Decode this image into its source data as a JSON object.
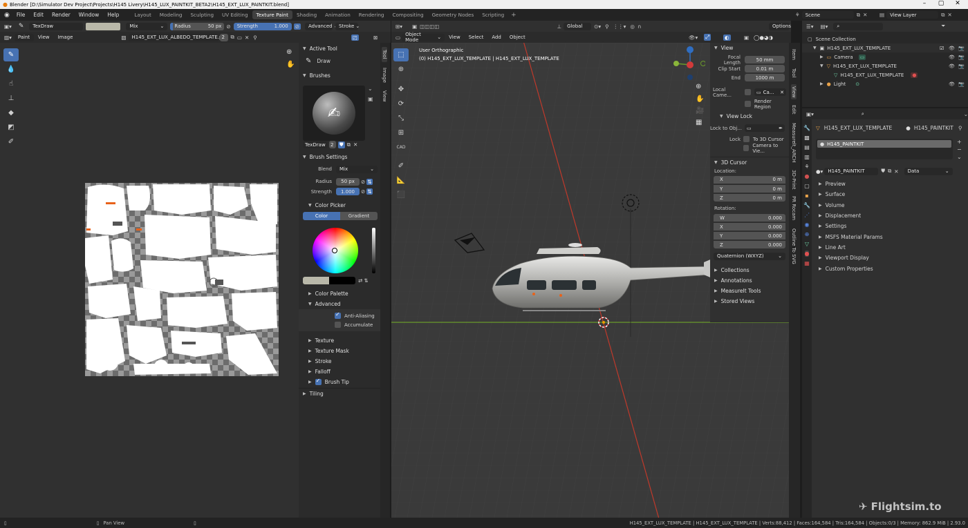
{
  "window": {
    "title": "Blender [D:\\Simulator Dev Project\\Projects\\H145 Livery\\H145_LUX_PAINTKIT_BETA2\\H145_EXT_LUX_PAINTKIT.blend]"
  },
  "menu": [
    "File",
    "Edit",
    "Render",
    "Window",
    "Help"
  ],
  "workspaces": [
    "Layout",
    "Modeling",
    "Sculpting",
    "UV Editing",
    "Texture Paint",
    "Shading",
    "Animation",
    "Rendering",
    "Compositing",
    "Geometry Nodes",
    "Scripting"
  ],
  "active_workspace": "Texture Paint",
  "scene": {
    "name": "Scene",
    "view_layer": "View Layer"
  },
  "tool_header": {
    "brush": "TexDraw",
    "blend": "Mix",
    "radius_label": "Radius",
    "radius_value": "50 px",
    "strength_label": "Strength",
    "strength_value": "1.000",
    "advanced": "Advanced",
    "stroke": "Stroke"
  },
  "image_editor": {
    "mode": "Paint",
    "view": "View",
    "image": "Image",
    "image_name": "H145_EXT_LUX_ALBEDO_TEMPLATE.png",
    "users": "2"
  },
  "sidebar": {
    "tabs": [
      "Tool",
      "Image",
      "View"
    ],
    "active_tool_header": "Active Tool",
    "active_tool": "Draw",
    "brushes_header": "Brushes",
    "brush_name": "TexDraw",
    "brush_users": "2",
    "brush_settings_header": "Brush Settings",
    "blend_label": "Blend",
    "blend_value": "Mix",
    "radius_label": "Radius",
    "radius_value": "50 px",
    "strength_label": "Strength",
    "strength_value": "1.000",
    "color_picker": "Color Picker",
    "color_tab": "Color",
    "gradient_tab": "Gradient",
    "color_palette": "Color Palette",
    "advanced": "Advanced",
    "anti_aliasing": "Anti-Aliasing",
    "accumulate": "Accumulate",
    "texture": "Texture",
    "texture_mask": "Texture Mask",
    "stroke": "Stroke",
    "falloff": "Falloff",
    "brush_tip": "Brush Tip",
    "tiling": "Tiling"
  },
  "viewport": {
    "mode": "Object Mode",
    "menus": [
      "View",
      "Select",
      "Add",
      "Object"
    ],
    "orientation": "Global",
    "options": "Options",
    "overlay_line1": "User Orthographic",
    "overlay_line2": "(0) H145_EXT_LUX_TEMPLATE | H145_EXT_LUX_TEMPLATE",
    "n_tabs": [
      "Item",
      "Tool",
      "View",
      "Edit",
      "Measurelt_ARCH",
      "3D-Print",
      "PR Rocam",
      "Outline To SVG"
    ],
    "view_panel": {
      "header": "View",
      "focal_length_label": "Focal Length",
      "focal_length": "50 mm",
      "clip_start_label": "Clip Start",
      "clip_start": "0.01 m",
      "end_label": "End",
      "end": "1000 m",
      "local_camera_label": "Local Came...",
      "local_camera_value": "Ca...",
      "render_region": "Render Region",
      "view_lock_header": "View Lock",
      "lock_to_obj_label": "Lock to Obj...",
      "lock_label": "Lock",
      "to_3d_cursor": "To 3D Cursor",
      "camera_to_view": "Camera to Vie..."
    },
    "cursor_panel": {
      "header": "3D Cursor",
      "location_label": "Location:",
      "x_label": "X",
      "x": "0 m",
      "y_label": "Y",
      "y": "0 m",
      "z_label": "Z",
      "z": "0 m",
      "rotation_label": "Rotation:",
      "w_label": "W",
      "w": "0.000",
      "rx_label": "X",
      "rx": "0.000",
      "ry_label": "Y",
      "ry": "0.000",
      "rz_label": "Z",
      "rz": "0.000",
      "rotation_mode": "Quaternion (WXYZ)"
    },
    "extra_panels": [
      "Collections",
      "Annotations",
      "MeasureIt Tools",
      "Stored Views"
    ]
  },
  "outliner": {
    "root": "Scene Collection",
    "items": [
      {
        "label": "H145_EXT_LUX_TEMPLATE",
        "level": 1,
        "icon": "collection-icon"
      },
      {
        "label": "Camera",
        "level": 2,
        "icon": "camera-icon"
      },
      {
        "label": "H145_EXT_LUX_TEMPLATE",
        "level": 2,
        "icon": "mesh-icon"
      },
      {
        "label": "H145_EXT_LUX_TEMPLATE",
        "level": 3,
        "icon": "mesh-data-icon"
      },
      {
        "label": "Light",
        "level": 2,
        "icon": "light-icon"
      }
    ]
  },
  "properties": {
    "object": "H145_EXT_LUX_TEMPLATE",
    "material": "H145_PAINTKIT",
    "slot": "H145_PAINTKIT",
    "material_field": "H145_PAINTKIT",
    "link": "Data",
    "sections": [
      "Preview",
      "Surface",
      "Volume",
      "Displacement",
      "Settings",
      "MSFS Material Params",
      "Line Art",
      "Viewport Display",
      "Custom Properties"
    ]
  },
  "statusbar": {
    "left": "Pan View",
    "right": "H145_EXT_LUX_TEMPLATE | H145_EXT_LUX_TEMPLATE | Verts:88,412 | Faces:164,584 | Tris:164,584 | Objects:0/3 | Memory: 862.9 MiB | 2.93.0"
  },
  "watermark": "Flightsim.to",
  "colors": {
    "accent": "#4772b3",
    "bg": "#1d1d1d",
    "panel": "#303030",
    "xaxis": "#c0392b",
    "yaxis": "#6b9a2a"
  }
}
